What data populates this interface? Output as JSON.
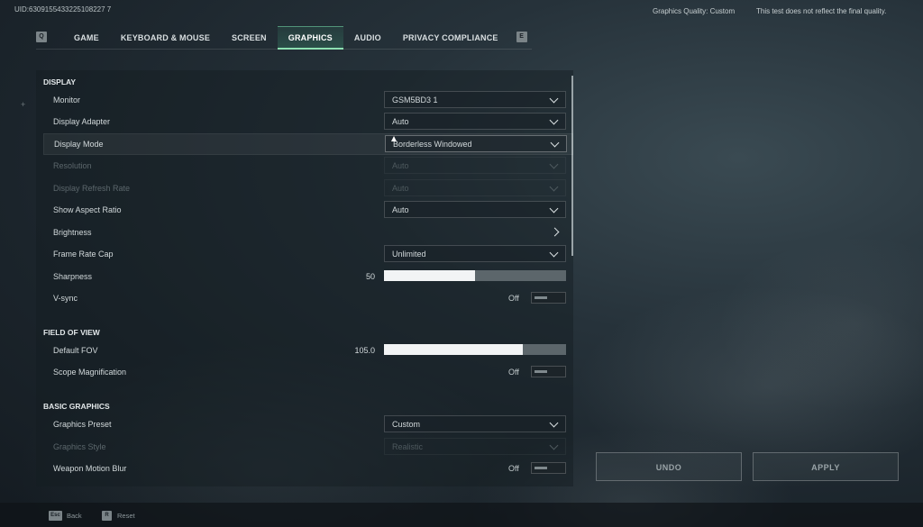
{
  "header": {
    "uid": "UID:6309155433225108227 7",
    "quality_label": "Graphics Quality: Custom",
    "test_note": "This test does not reflect the final quality."
  },
  "tabs": {
    "left_key": "Q",
    "right_key": "E",
    "items": [
      {
        "label": "GAME"
      },
      {
        "label": "KEYBOARD & MOUSE"
      },
      {
        "label": "SCREEN"
      },
      {
        "label": "GRAPHICS",
        "active": true
      },
      {
        "label": "AUDIO"
      },
      {
        "label": "PRIVACY COMPLIANCE"
      }
    ]
  },
  "sections": {
    "display": "DISPLAY",
    "fov": "FIELD OF VIEW",
    "basic": "BASIC GRAPHICS"
  },
  "display": {
    "monitor": {
      "label": "Monitor",
      "value": "GSM5BD3 1"
    },
    "adapter": {
      "label": "Display Adapter",
      "value": "Auto"
    },
    "mode": {
      "label": "Display Mode",
      "value": "Borderless Windowed"
    },
    "resolution": {
      "label": "Resolution",
      "value": "Auto"
    },
    "refresh": {
      "label": "Display Refresh Rate",
      "value": "Auto"
    },
    "aspect": {
      "label": "Show Aspect Ratio",
      "value": "Auto"
    },
    "brightness": {
      "label": "Brightness"
    },
    "framecap": {
      "label": "Frame Rate Cap",
      "value": "Unlimited"
    },
    "sharpness": {
      "label": "Sharpness",
      "value": "50",
      "fraction": 0.5
    },
    "vsync": {
      "label": "V-sync",
      "value": "Off"
    }
  },
  "fov": {
    "default": {
      "label": "Default FOV",
      "value": "105.0",
      "fraction": 0.76
    },
    "scope": {
      "label": "Scope Magnification",
      "value": "Off"
    }
  },
  "basic": {
    "preset": {
      "label": "Graphics Preset",
      "value": "Custom"
    },
    "style": {
      "label": "Graphics Style",
      "value": "Realistic"
    },
    "motion_blur": {
      "label": "Weapon Motion Blur",
      "value": "Off"
    }
  },
  "buttons": {
    "undo": "UNDO",
    "apply": "APPLY"
  },
  "footer": {
    "back_key": "Esc",
    "back": "Back",
    "reset_key": "R",
    "reset": "Reset"
  },
  "colors": {
    "accent": "#8de0b2",
    "slider_fill": "#f2f4f5",
    "slider_track": "#5c666b"
  }
}
